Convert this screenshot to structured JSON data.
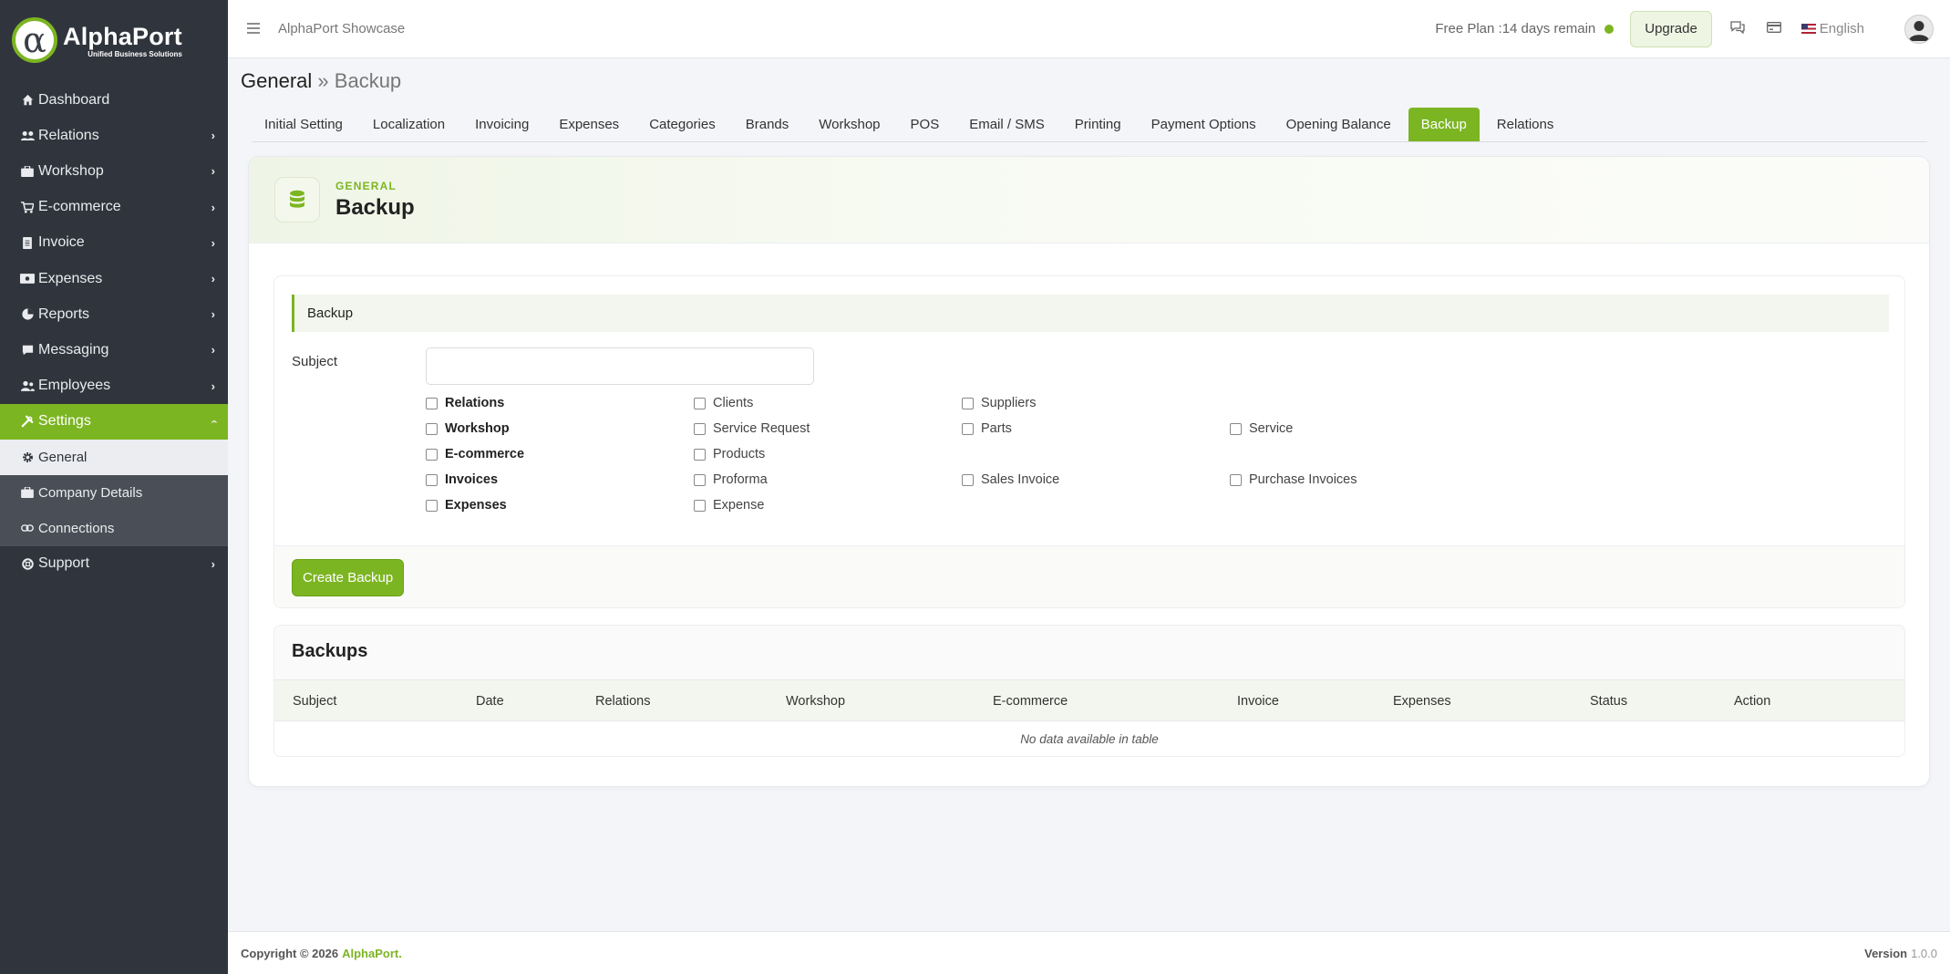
{
  "brand": {
    "name": "AlphaPort",
    "tagline": "Unified Business Solutions",
    "accent": "#7cb522"
  },
  "sidebar": {
    "items": [
      {
        "label": "Dashboard",
        "icon": "home-icon"
      },
      {
        "label": "Relations",
        "icon": "users-icon"
      },
      {
        "label": "Workshop",
        "icon": "briefcase-icon"
      },
      {
        "label": "E-commerce",
        "icon": "cart-icon"
      },
      {
        "label": "Invoice",
        "icon": "document-icon"
      },
      {
        "label": "Expenses",
        "icon": "money-icon"
      },
      {
        "label": "Reports",
        "icon": "pie-chart-icon"
      },
      {
        "label": "Messaging",
        "icon": "message-icon"
      },
      {
        "label": "Employees",
        "icon": "user-group-icon"
      },
      {
        "label": "Settings",
        "icon": "tools-icon"
      }
    ],
    "settings_sub": [
      {
        "label": "General",
        "icon": "gear-icon"
      },
      {
        "label": "Company Details",
        "icon": "briefcase-icon"
      },
      {
        "label": "Connections",
        "icon": "link-icon"
      }
    ],
    "support": {
      "label": "Support",
      "icon": "lifebuoy-icon"
    }
  },
  "topbar": {
    "title": "AlphaPort Showcase",
    "plan": "Free Plan :14 days remain",
    "upgrade": "Upgrade",
    "language": "English"
  },
  "breadcrumb": {
    "root": "General",
    "sep": "»",
    "current": "Backup"
  },
  "tabs": [
    "Initial Setting",
    "Localization",
    "Invoicing",
    "Expenses",
    "Categories",
    "Brands",
    "Workshop",
    "POS",
    "Email / SMS",
    "Printing",
    "Payment Options",
    "Opening Balance",
    "Backup",
    "Relations"
  ],
  "header": {
    "eyebrow": "GENERAL",
    "title": "Backup"
  },
  "form": {
    "section": "Backup",
    "subject_label": "Subject",
    "subject_value": "",
    "rows": [
      [
        "Relations",
        "Clients",
        "Suppliers"
      ],
      [
        "Workshop",
        "Service Request",
        "Parts",
        "Service"
      ],
      [
        "E-commerce",
        "Products"
      ],
      [
        "Invoices",
        "Proforma",
        "Sales Invoice",
        "Purchase Invoices"
      ],
      [
        "Expenses",
        "Expense"
      ]
    ],
    "create_button": "Create Backup"
  },
  "backups": {
    "title": "Backups",
    "columns": [
      "Subject",
      "Date",
      "Relations",
      "Workshop",
      "E-commerce",
      "Invoice",
      "Expenses",
      "Status",
      "Action"
    ],
    "empty": "No data available in table"
  },
  "footer": {
    "copyright": "Copyright © 2026",
    "brand": "AlphaPort.",
    "version_label": "Version",
    "version": "1.0.0"
  }
}
